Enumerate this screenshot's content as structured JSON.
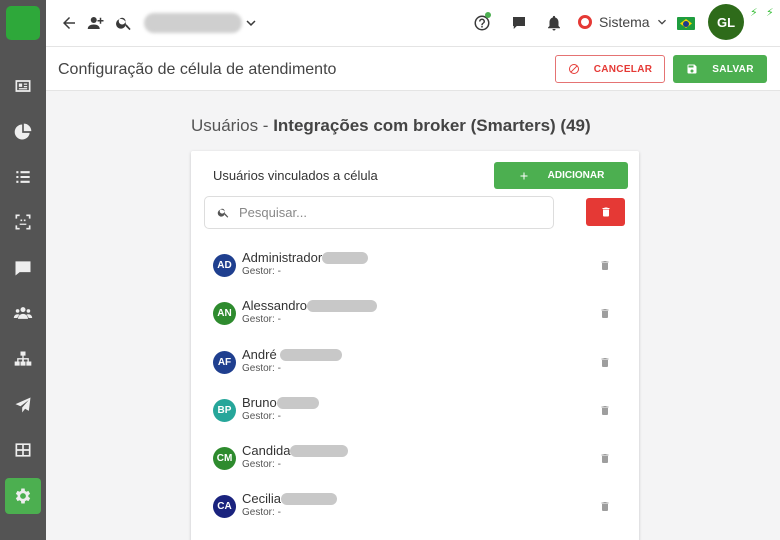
{
  "sidebar": {
    "items": [
      {
        "icon": "contact-card-icon",
        "active": false
      },
      {
        "icon": "pie-chart-icon",
        "active": false
      },
      {
        "icon": "list-icon",
        "active": false
      },
      {
        "icon": "face-scan-icon",
        "active": false
      },
      {
        "icon": "chat-icon",
        "active": false
      },
      {
        "icon": "users-group-icon",
        "active": false
      },
      {
        "icon": "network-icon",
        "active": false
      },
      {
        "icon": "send-icon",
        "active": false
      },
      {
        "icon": "table-icon",
        "active": false
      },
      {
        "icon": "gear-icon",
        "active": true
      }
    ]
  },
  "topbar": {
    "status_label": "Sistema",
    "avatar_initials": "GL"
  },
  "header": {
    "title": "Configuração de célula de atendimento",
    "cancel_label": "CANCELAR",
    "save_label": "SALVAR"
  },
  "section": {
    "prefix": "Usuários - ",
    "group_name": "Integrações com broker (Smarters) (49)"
  },
  "card": {
    "title": "Usuários vinculados a célula",
    "add_label": "ADICIONAR",
    "search_placeholder": "Pesquisar..."
  },
  "users": [
    {
      "initials": "AD",
      "name": "Administrador",
      "sub": "Gestor: -",
      "color": "#1f3f8f"
    },
    {
      "initials": "AN",
      "name": "Alessandro",
      "sub": "Gestor: -",
      "color": "#2e8b2e"
    },
    {
      "initials": "AF",
      "name": "André",
      "sub": "Gestor: -",
      "color": "#1f3f8f"
    },
    {
      "initials": "BP",
      "name": "Bruno",
      "sub": "Gestor: -",
      "color": "#26a69a"
    },
    {
      "initials": "CM",
      "name": "Candida",
      "sub": "Gestor: -",
      "color": "#2e8b2e"
    },
    {
      "initials": "CA",
      "name": "Cecilia",
      "sub": "Gestor: -",
      "color": "#1a237e"
    }
  ],
  "colors": {
    "accent": "#4caf50",
    "danger": "#e53935",
    "sidebar": "#545454"
  }
}
